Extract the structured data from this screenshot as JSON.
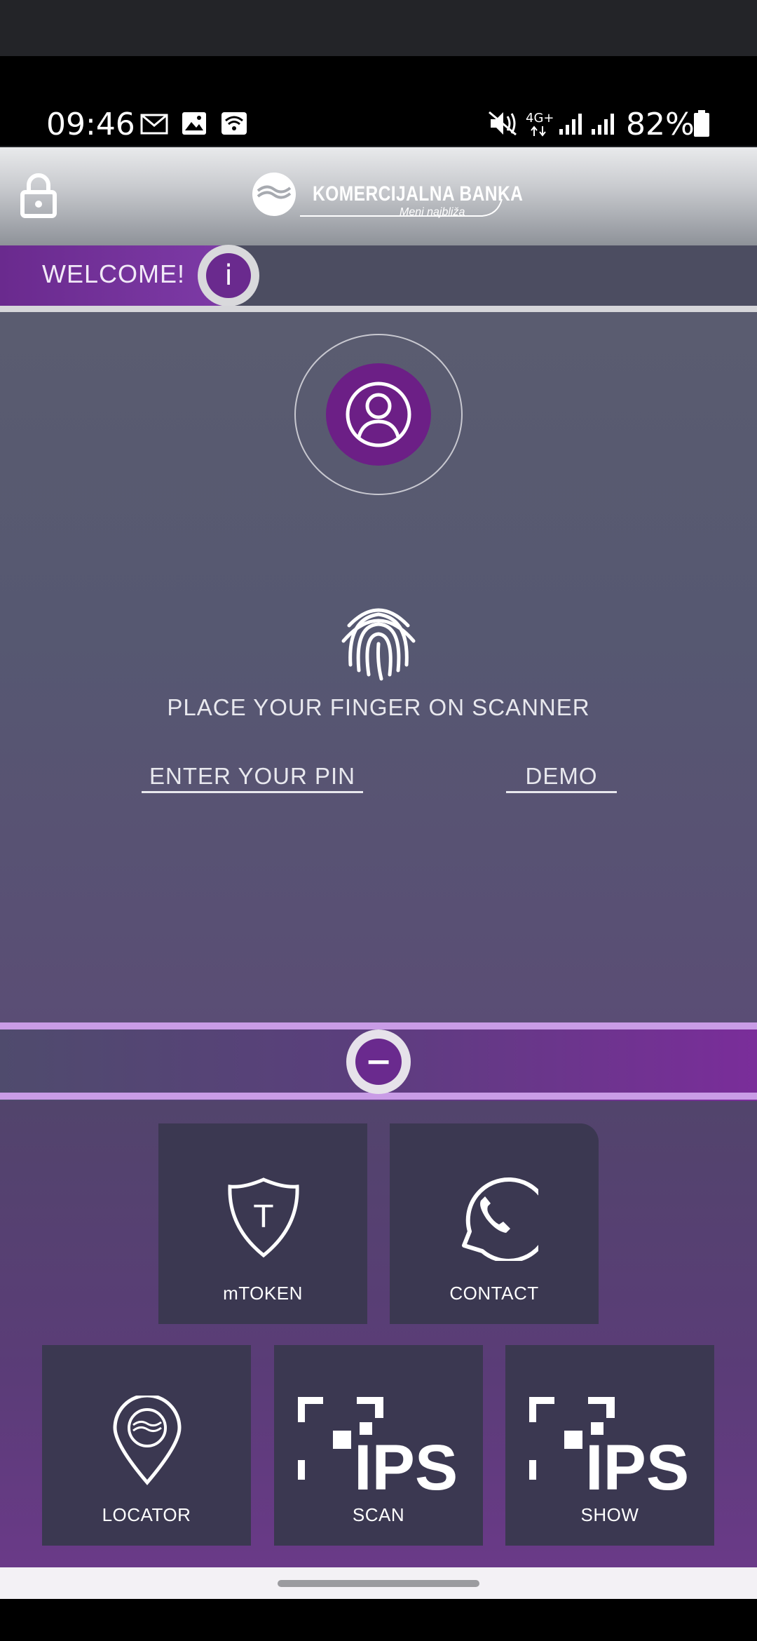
{
  "status_bar": {
    "time": "09:46",
    "battery": "82%",
    "network": "4G+",
    "icons": [
      "mail-icon",
      "image-icon",
      "wifi-calling-icon",
      "mute-icon",
      "signal-icon",
      "battery-icon"
    ]
  },
  "header": {
    "brand": "KOMERCIJALNA BANKA",
    "tagline": "Meni najbliža",
    "lock_icon": "lock-icon"
  },
  "welcome": {
    "text": "WELCOME!",
    "info_glyph": "i"
  },
  "login": {
    "fingerprint_text": "PLACE YOUR FINGER ON SCANNER",
    "pin_link": "ENTER YOUR PIN",
    "demo_link": "DEMO"
  },
  "collapse_glyph": "−",
  "tiles": [
    {
      "label": "mTOKEN",
      "icon": "shield-token-icon",
      "glyph": "T"
    },
    {
      "label": "CONTACT",
      "icon": "phone-icon"
    },
    {
      "label": "LOCATOR",
      "icon": "location-pin-icon"
    },
    {
      "label": "SCAN",
      "icon": "ips-scan-icon",
      "glyph": "IPS"
    },
    {
      "label": "SHOW",
      "icon": "ips-show-icon",
      "glyph": "IPS"
    }
  ],
  "colors": {
    "accent_purple": "#7a2d9a",
    "panel_bg": "#565871",
    "tile_bg": "#3b3851"
  }
}
